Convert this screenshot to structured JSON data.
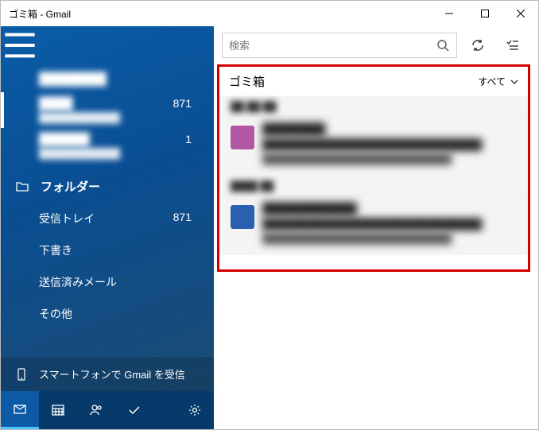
{
  "window": {
    "title": "ゴミ箱 - Gmail"
  },
  "search": {
    "placeholder": "検索"
  },
  "accounts": [
    {
      "name": "████████",
      "addr": "",
      "badge": ""
    },
    {
      "name": "████",
      "addr": "████████████",
      "badge": "871"
    },
    {
      "name": "██████",
      "addr": "████████████",
      "badge": "1"
    }
  ],
  "folders_label": "フォルダー",
  "folders": [
    {
      "label": "受信トレイ",
      "badge": "871"
    },
    {
      "label": "下書き",
      "badge": ""
    },
    {
      "label": "送信済みメール",
      "badge": ""
    },
    {
      "label": "その他",
      "badge": ""
    }
  ],
  "promo": "スマートフォンで Gmail を受信",
  "list": {
    "title": "ゴミ箱",
    "filter": "すべて",
    "groups": [
      {
        "date": "██ ██ ██",
        "items": [
          {
            "avatar_color": "#b157a4",
            "sender": "████████",
            "subject": "██████████████████████████████",
            "preview": "████████████████████████████"
          }
        ]
      },
      {
        "date": "████ ██",
        "items": [
          {
            "avatar_color": "#2b5fb0",
            "sender": "████████████",
            "subject": "██████████████████████████████",
            "preview": "████████████████████████████"
          }
        ]
      }
    ]
  }
}
